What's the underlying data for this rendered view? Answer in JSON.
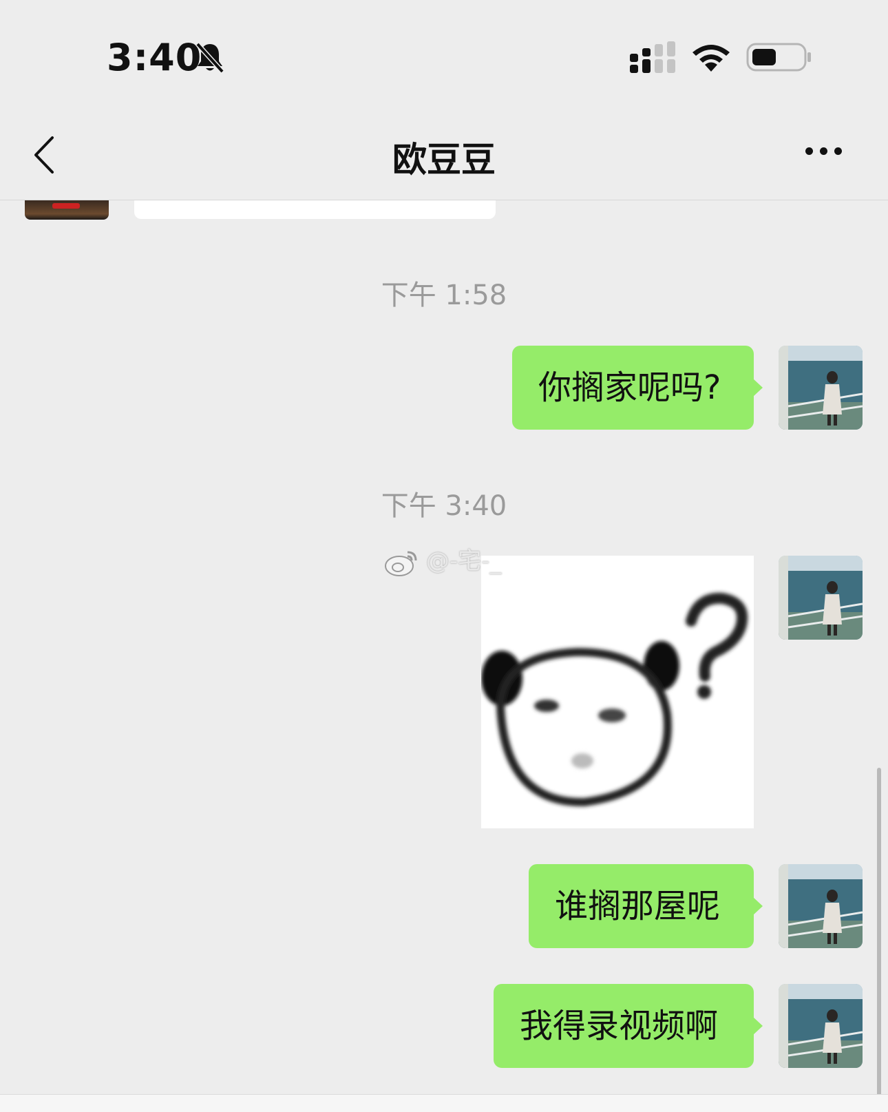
{
  "status_bar": {
    "time": "3:40",
    "icons": [
      "bell-slash-icon",
      "signal-icon",
      "wifi-icon",
      "battery-icon"
    ]
  },
  "nav": {
    "title": "欧豆豆",
    "back_icon": "chevron-left-icon",
    "more_icon": "ellipsis-icon"
  },
  "messages": {
    "timestamp_1": "下午 1:58",
    "timestamp_2": "下午 3:40",
    "msg_1": "你搁家呢吗?",
    "msg_2": "谁搁那屋呢",
    "msg_3": "我得录视频啊"
  },
  "sticker": {
    "description_icon": "panda-question-sticker"
  },
  "watermark": {
    "text": "@-宅-_"
  },
  "colors": {
    "background": "#ededed",
    "bubble_sent": "#95ec69",
    "timestamp": "#9a9a9a"
  }
}
